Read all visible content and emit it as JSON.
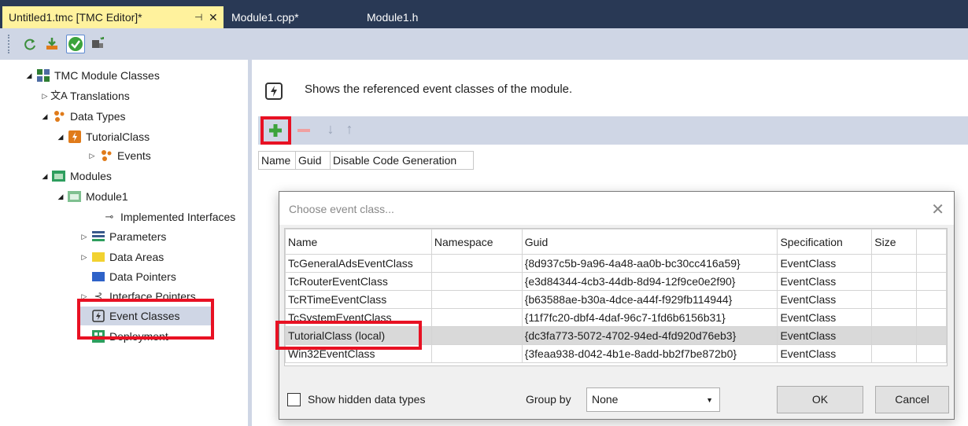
{
  "tabs": [
    {
      "label": "Untitled1.tmc [TMC Editor]*",
      "active": true
    },
    {
      "label": "Module1.cpp*",
      "active": false
    },
    {
      "label": "Module1.h",
      "active": false
    }
  ],
  "tab_icons": {
    "pin": "pin-icon",
    "close": "close-icon"
  },
  "toolbar": {
    "icons": [
      "refresh-icon",
      "download-icon",
      "check-icon",
      "wizard-icon"
    ]
  },
  "tree": {
    "root": "TMC Module Classes",
    "translations": "Translations",
    "data_types": "Data Types",
    "tutorial_class": "TutorialClass",
    "events": "Events",
    "modules": "Modules",
    "module1": "Module1",
    "implemented_interfaces": "Implemented Interfaces",
    "parameters": "Parameters",
    "data_areas": "Data Areas",
    "data_pointers": "Data Pointers",
    "interface_pointers": "Interface Pointers",
    "event_classes": "Event Classes",
    "deployment": "Deployment"
  },
  "editor": {
    "description": "Shows the referenced event classes of the module.",
    "columns": [
      "Name",
      "Guid",
      "Disable Code Generation"
    ]
  },
  "dialog": {
    "title": "Choose event class...",
    "columns": [
      "Name",
      "Namespace",
      "Guid",
      "Specification",
      "Size"
    ],
    "rows": [
      {
        "name": "TcGeneralAdsEventClass",
        "namespace": "",
        "guid": "{8d937c5b-9a96-4a48-aa0b-bc30cc416a59}",
        "spec": "EventClass",
        "size": ""
      },
      {
        "name": "TcRouterEventClass",
        "namespace": "",
        "guid": "{e3d84344-4cb3-44db-8d94-12f9ce0e2f90}",
        "spec": "EventClass",
        "size": ""
      },
      {
        "name": "TcRTimeEventClass",
        "namespace": "",
        "guid": "{b63588ae-b30a-4dce-a44f-f929fb114944}",
        "spec": "EventClass",
        "size": ""
      },
      {
        "name": "TcSystemEventClass",
        "namespace": "",
        "guid": "{11f7fc20-dbf4-4daf-96c7-1fd6b6156b31}",
        "spec": "EventClass",
        "size": ""
      },
      {
        "name": "TutorialClass (local)",
        "namespace": "",
        "guid": "{dc3fa773-5072-4702-94ed-4fd920d76eb3}",
        "spec": "EventClass",
        "size": ""
      },
      {
        "name": "Win32EventClass",
        "namespace": "",
        "guid": "{3feaa938-d042-4b1e-8add-bb2f7be872b0}",
        "spec": "EventClass",
        "size": ""
      }
    ],
    "selected_row": 4,
    "show_hidden_label": "Show hidden data types",
    "group_by_label": "Group by",
    "group_by_value": "None",
    "ok_label": "OK",
    "cancel_label": "Cancel"
  },
  "colors": {
    "highlight": "#e81123",
    "tabbar": "#293955",
    "active_tab": "#fff29d",
    "toolbar": "#cfd6e5"
  }
}
